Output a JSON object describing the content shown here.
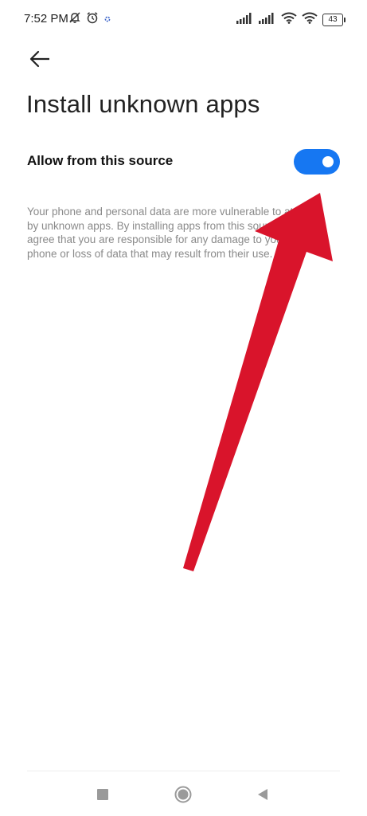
{
  "status_bar": {
    "time": "7:52 PM",
    "battery_level": "43",
    "icons": [
      "muted-notification-icon",
      "alarm-icon",
      "sync-icon",
      "signal-icon",
      "signal-icon",
      "wifi-icon",
      "wifi-icon",
      "battery-icon"
    ]
  },
  "header": {
    "back_icon": "arrow-left-icon",
    "title": "Install unknown apps"
  },
  "setting": {
    "label": "Allow from this source",
    "toggle_on": true,
    "toggle_color": "#1677f2"
  },
  "description": {
    "text": "Your phone and personal data are more vulnerable to attack by unknown apps. By installing apps from this source, you agree that you are responsible for any damage to your phone or loss of data that may result from their use."
  },
  "annotation": {
    "type": "arrow",
    "color": "#d9142b"
  },
  "nav_bar": {
    "icons": [
      "recents-square-icon",
      "home-circle-icon",
      "back-triangle-icon"
    ]
  }
}
